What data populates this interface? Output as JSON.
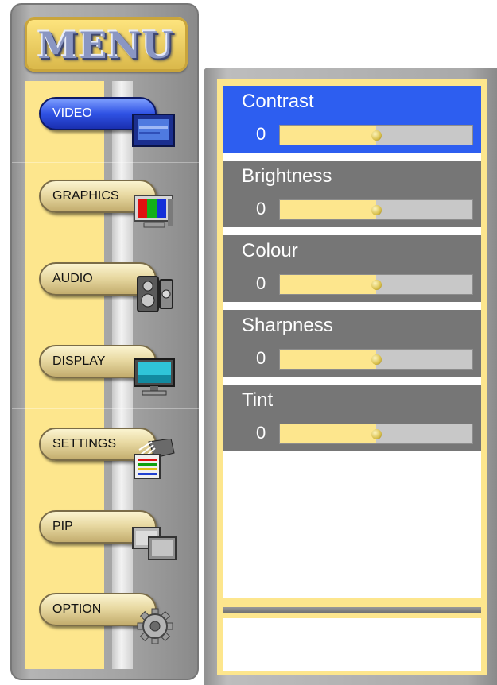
{
  "menu": {
    "title": "MENU",
    "items": [
      {
        "label": "VIDEO",
        "icon": "video-monitor-icon",
        "active": true
      },
      {
        "label": "GRAPHICS",
        "icon": "color-monitor-icon",
        "active": false
      },
      {
        "label": "AUDIO",
        "icon": "speaker-icon",
        "active": false
      },
      {
        "label": "DISPLAY",
        "icon": "display-screen-icon",
        "active": false
      },
      {
        "label": "SETTINGS",
        "icon": "settings-document-icon",
        "active": false
      },
      {
        "label": "PIP",
        "icon": "picture-in-picture-icon",
        "active": false
      },
      {
        "label": "OPTION",
        "icon": "gear-icon",
        "active": false
      }
    ]
  },
  "settings": {
    "items": [
      {
        "name": "Contrast",
        "value": "0",
        "level": 0.5,
        "selected": true
      },
      {
        "name": "Brightness",
        "value": "0",
        "level": 0.5,
        "selected": false
      },
      {
        "name": "Colour",
        "value": "0",
        "level": 0.5,
        "selected": false
      },
      {
        "name": "Sharpness",
        "value": "0",
        "level": 0.5,
        "selected": false
      },
      {
        "name": "Tint",
        "value": "0",
        "level": 0.5,
        "selected": false
      }
    ]
  },
  "colors": {
    "accent_blue": "#2d5ef0",
    "panel_yellow": "#fde68d",
    "row_gray": "#767676"
  }
}
